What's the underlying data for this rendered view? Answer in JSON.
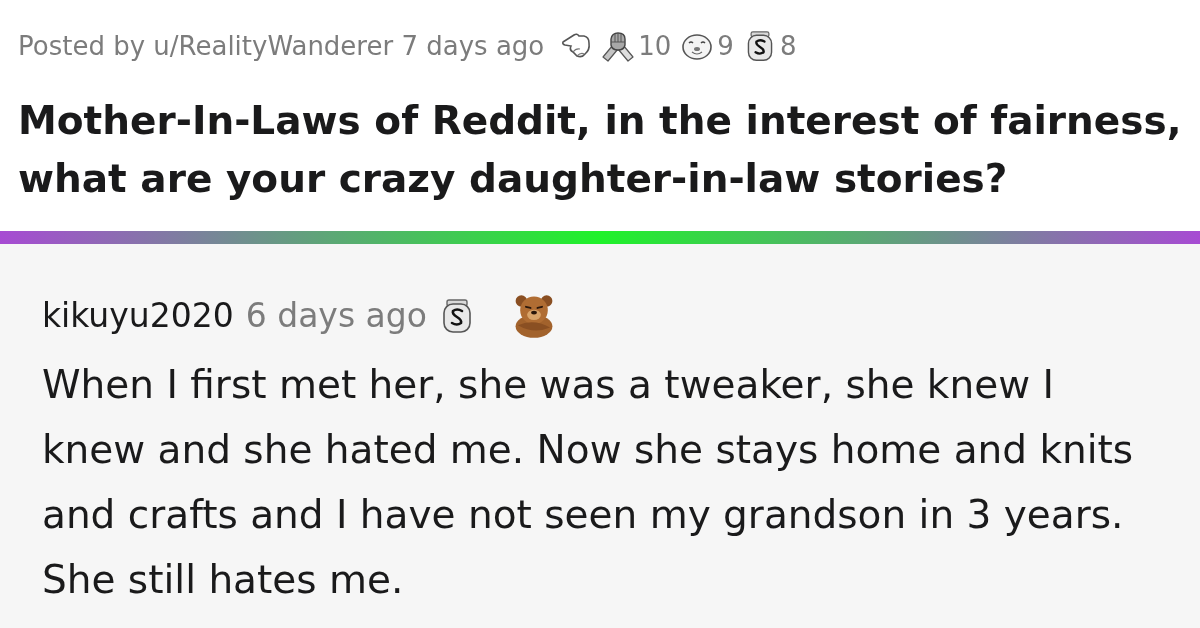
{
  "post": {
    "byline": "Posted by u/RealityWanderer 7 days ago",
    "awards": [
      {
        "kind": "hand"
      },
      {
        "kind": "armwrestle",
        "count": "10"
      },
      {
        "kind": "seal",
        "count": "9"
      },
      {
        "kind": "coin",
        "count": "8"
      }
    ],
    "title": "Mother-In-Laws of Reddit, in the interest of fairness, what are your crazy daughter-in-law stories?"
  },
  "comment": {
    "author": "kikuyu2020",
    "time": "6 days ago",
    "awards": [
      {
        "kind": "coin"
      },
      {
        "kind": "bear"
      }
    ],
    "body": "When I first met her, she was a tweaker, she knew I knew and she hated me. Now she stays home and knits and crafts and I have not seen my grandson in 3 years. She still hates me."
  }
}
